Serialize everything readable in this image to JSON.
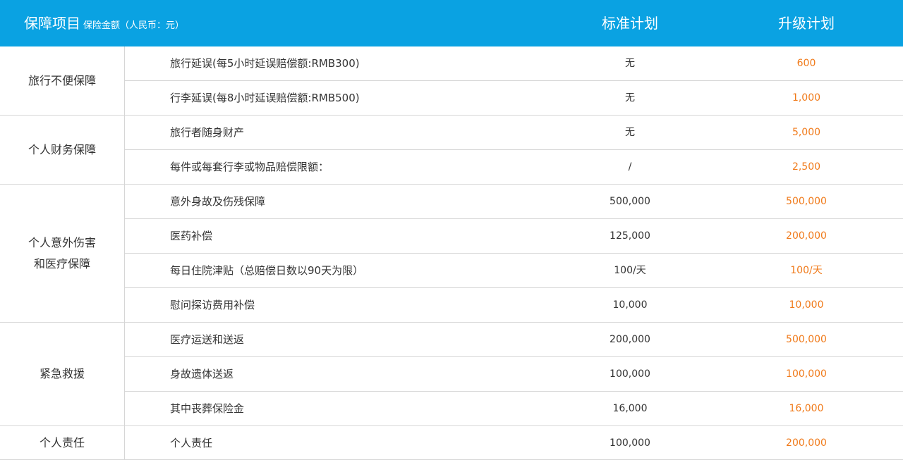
{
  "header": {
    "title": "保障项目",
    "subtitle": "保险金额（人民币：元）",
    "col_standard": "标准计划",
    "col_upgrade": "升级计划"
  },
  "categories": [
    {
      "label": "旅行不便保障"
    },
    {
      "label": "个人财务保障"
    },
    {
      "label": "个人意外伤害\n和医疗保障"
    },
    {
      "label": "紧急救援"
    },
    {
      "label": "个人责任"
    }
  ],
  "rows": [
    {
      "item": "旅行延误(每5小时延误赔偿额:RMB300)",
      "standard": "无",
      "upgrade": "600"
    },
    {
      "item": "行李延误(每8小时延误赔偿额:RMB500)",
      "standard": "无",
      "upgrade": "1,000"
    },
    {
      "item": "旅行者随身财产",
      "standard": "无",
      "upgrade": "5,000"
    },
    {
      "item": "每件或每套行李或物品赔偿限额：",
      "standard": "/",
      "upgrade": "2,500"
    },
    {
      "item": "意外身故及伤残保障",
      "standard": "500,000",
      "upgrade": "500,000"
    },
    {
      "item": "医药补偿",
      "standard": "125,000",
      "upgrade": "200,000"
    },
    {
      "item": "每日住院津贴（总赔偿日数以90天为限）",
      "standard": "100/天",
      "upgrade": "100/天"
    },
    {
      "item": "慰问探访费用补偿",
      "standard": "10,000",
      "upgrade": "10,000"
    },
    {
      "item": "医疗运送和送返",
      "standard": "200,000",
      "upgrade": "500,000"
    },
    {
      "item": "身故遗体送返",
      "standard": "100,000",
      "upgrade": "100,000"
    },
    {
      "item": "其中丧葬保险金",
      "standard": "16,000",
      "upgrade": "16,000"
    },
    {
      "item": "个人责任",
      "standard": "100,000",
      "upgrade": "200,000"
    }
  ],
  "colors": {
    "header_bg": "#0aa2e2",
    "upgrade_text": "#f07a1a",
    "border": "#d6d6d6"
  }
}
